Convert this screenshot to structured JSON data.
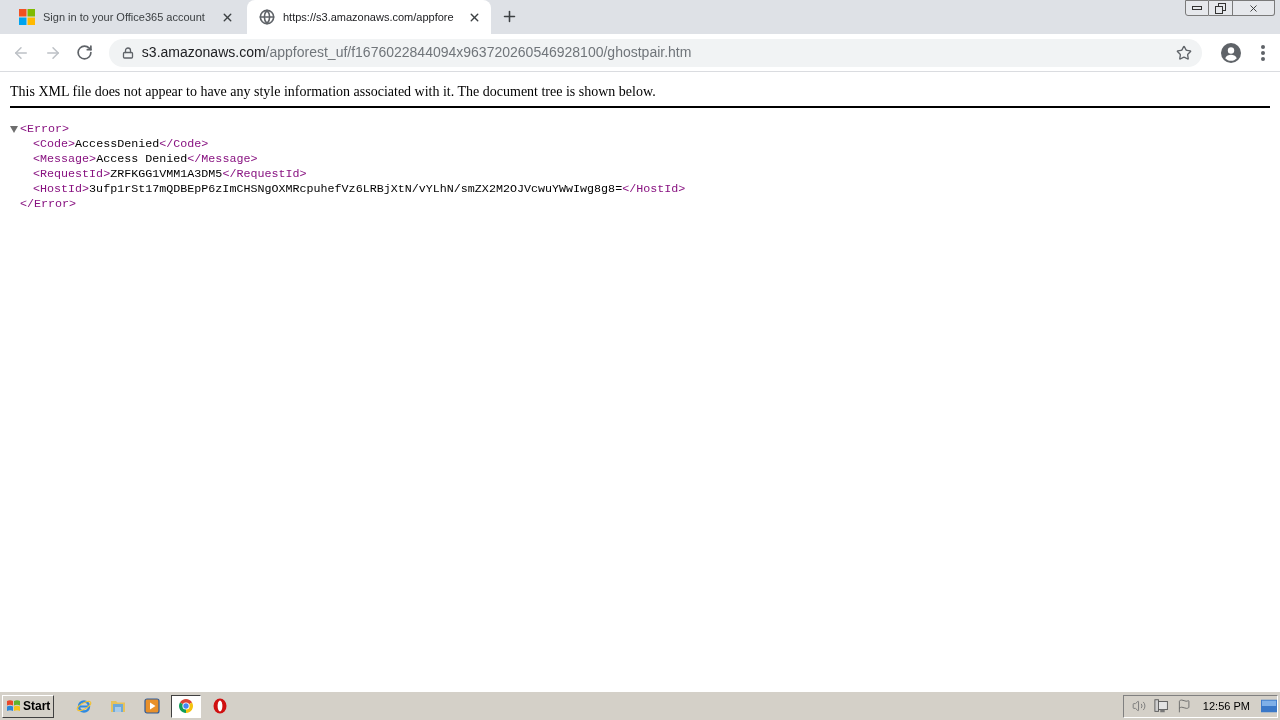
{
  "browser": {
    "tabs": [
      {
        "kind": "microsoft",
        "title": "Sign in to your Office365 account",
        "selected": false
      },
      {
        "kind": "globe",
        "title": "https://s3.amazonaws.com/appfore",
        "selected": true
      }
    ],
    "toolbar": [
      {
        "kind": "back",
        "disabled": true
      },
      {
        "kind": "forward",
        "disabled": true
      },
      {
        "kind": "reload",
        "disabled": false
      }
    ],
    "address_bar": {
      "host": "s3.amazonaws.com",
      "path": "/appforest_uf/f1676022844094x963720260546928100/ghostpair.htm"
    }
  },
  "page": {
    "notice": "This XML file does not appear to have any style information associated with it. The document tree is shown below.",
    "xml": {
      "open": "<Error>",
      "close": "</Error>",
      "expanded": true,
      "children": [
        {
          "open": "<Code>",
          "text": "AccessDenied",
          "close": "</Code>"
        },
        {
          "open": "<Message>",
          "text": "Access Denied",
          "close": "</Message>"
        },
        {
          "open": "<RequestId>",
          "text": "ZRFKGG1VMM1A3DM5",
          "close": "</RequestId>"
        },
        {
          "open": "<HostId>",
          "text": "3ufp1rSt17mQDBEpP6zImCHSNgOXMRcpuhefVz6LRBjXtN/vYLhN/smZX2M2OJVcwuYWwIwg8g8=",
          "close": "</HostId>"
        }
      ]
    }
  },
  "taskbar": {
    "start": "Start",
    "apps": [
      {
        "kind": "ie",
        "selected": false
      },
      {
        "kind": "folder",
        "selected": false
      },
      {
        "kind": "media",
        "selected": false
      },
      {
        "kind": "chrome",
        "selected": true
      },
      {
        "kind": "opera",
        "selected": false
      }
    ],
    "clock": "12:56 PM"
  }
}
